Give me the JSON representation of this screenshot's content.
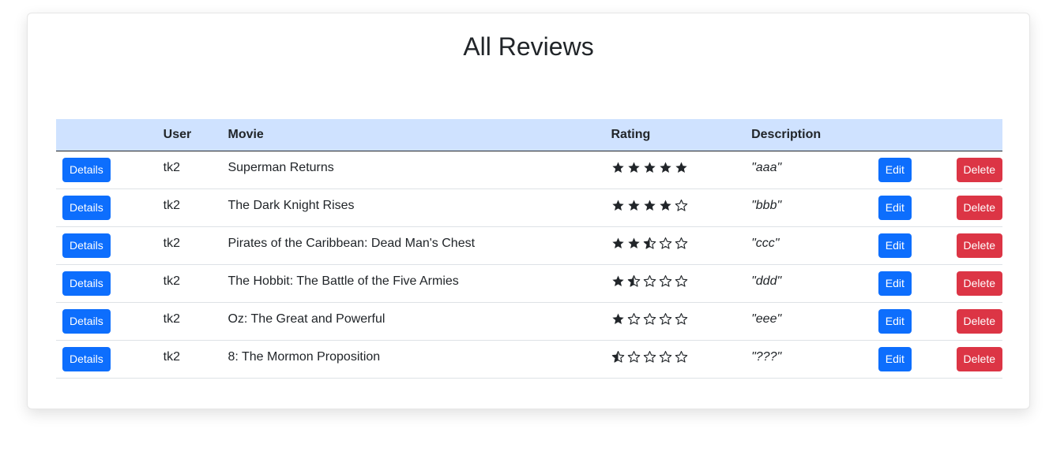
{
  "page": {
    "title": "All Reviews"
  },
  "table": {
    "headers": [
      "",
      "User",
      "Movie",
      "Rating",
      "Description",
      "",
      ""
    ],
    "details_label": "Details",
    "edit_label": "Edit",
    "delete_label": "Delete",
    "rows": [
      {
        "user": "tk2",
        "movie": "Superman Returns",
        "rating": 5,
        "description": "\"aaa\""
      },
      {
        "user": "tk2",
        "movie": "The Dark Knight Rises",
        "rating": 4,
        "description": "\"bbb\""
      },
      {
        "user": "tk2",
        "movie": "Pirates of the Caribbean: Dead Man's Chest",
        "rating": 2.5,
        "description": "\"ccc\""
      },
      {
        "user": "tk2",
        "movie": "The Hobbit: The Battle of the Five Armies",
        "rating": 1.5,
        "description": "\"ddd\""
      },
      {
        "user": "tk2",
        "movie": "Oz: The Great and Powerful",
        "rating": 1,
        "description": "\"eee\""
      },
      {
        "user": "tk2",
        "movie": "8: The Mormon Proposition",
        "rating": 0.5,
        "description": "\"???\""
      }
    ]
  },
  "colors": {
    "header_bg": "#cfe2ff",
    "primary": "#0d6efd",
    "danger": "#dc3545",
    "star": "#212529"
  },
  "icons": {
    "full": "star-full-icon",
    "half": "star-half-icon",
    "empty": "star-empty-icon"
  }
}
